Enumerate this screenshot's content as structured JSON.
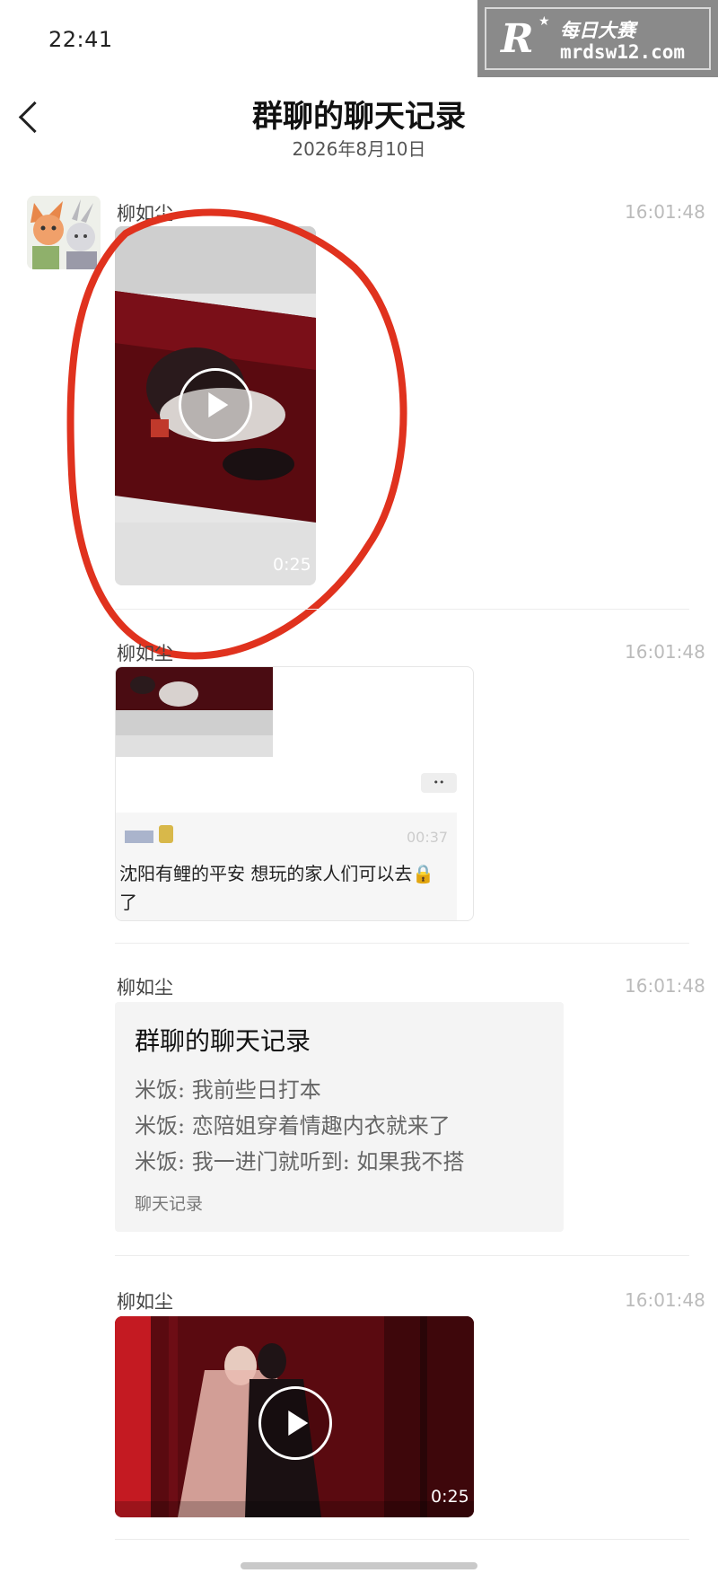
{
  "status_bar": {
    "time": "22:41"
  },
  "watermark": {
    "logo_letter": "R",
    "star": "★",
    "text_cn": "每日大赛",
    "url": "mrdsw12.com"
  },
  "header": {
    "title": "群聊的聊天记录",
    "date": "2026年8月10日"
  },
  "messages": [
    {
      "sender": "柳如尘",
      "time": "16:01:48",
      "type": "video",
      "duration": "0:25"
    },
    {
      "sender": "柳如尘",
      "time": "16:01:48",
      "type": "shared-video",
      "more": "••",
      "user_time": "00:37",
      "caption_line1": "沈阳有鲤的平安 想玩的家人们可以去🔒",
      "caption_line2": "了"
    },
    {
      "sender": "柳如尘",
      "time": "16:01:48",
      "type": "chat-record",
      "card_title": "群聊的聊天记录",
      "lines": [
        "米饭: 我前些日打本",
        "米饭: 恋陪姐穿着情趣内衣就来了",
        "米饭: 我一进门就听到: 如果我不搭"
      ],
      "footer": "聊天记录"
    },
    {
      "sender": "柳如尘",
      "time": "16:01:48",
      "type": "video",
      "duration": "0:25"
    }
  ],
  "colors": {
    "annotation_circle": "#e0321e",
    "video_dark_red": "#5a0a10",
    "card_bg": "#f4f4f4"
  },
  "icons": [
    "back-chevron-icon",
    "play-icon",
    "lock-icon"
  ]
}
